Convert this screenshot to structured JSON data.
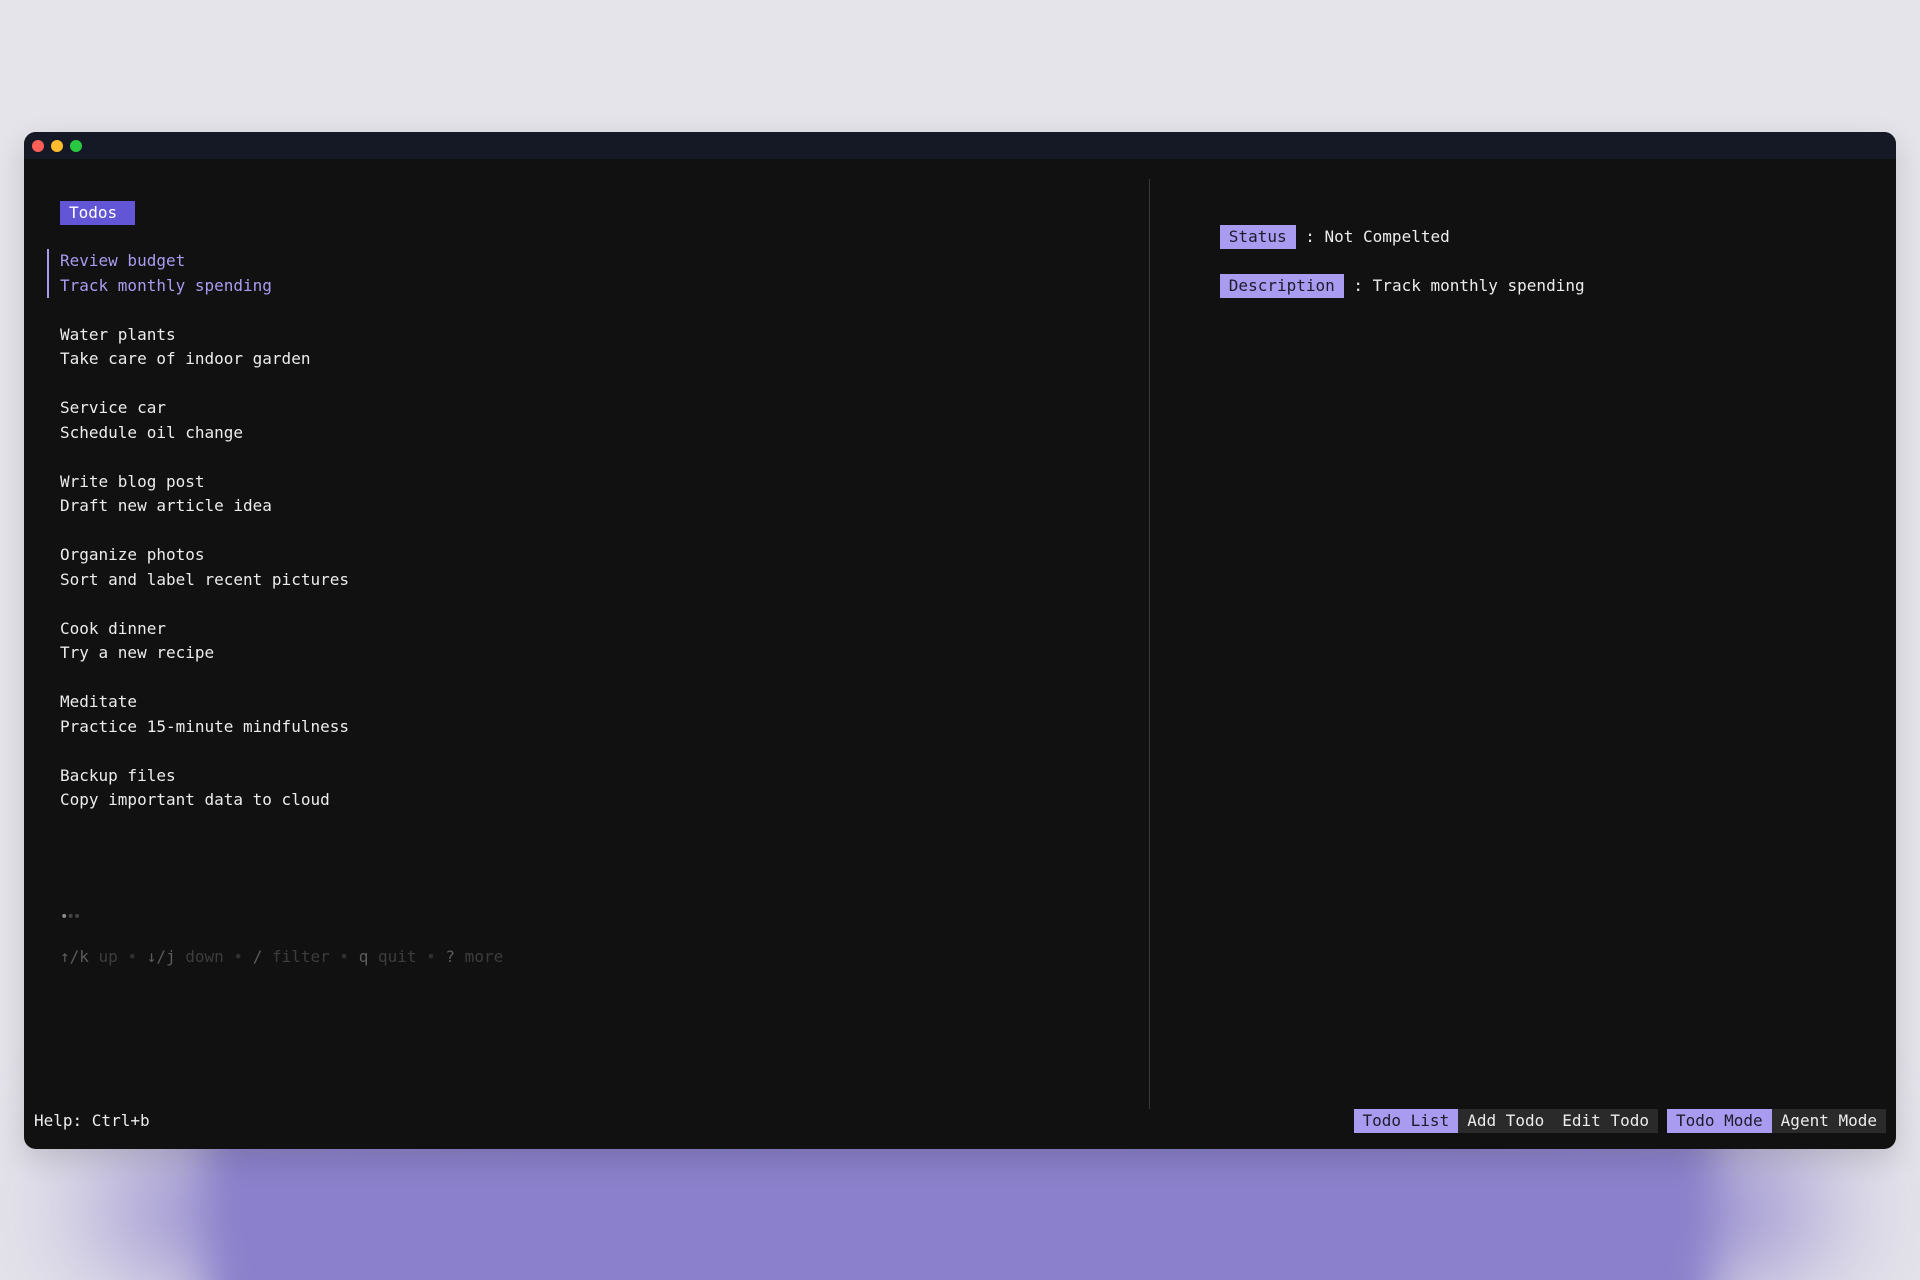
{
  "colors": {
    "accent": "#a99cf0",
    "accent_strong": "#6256d6",
    "divider": "#3a3a3a",
    "window_bg": "#111111",
    "titlebar_bg": "#141925",
    "close": "#ff5f57",
    "minimize": "#febc2e",
    "maximize": "#28c840",
    "tab_bg": "#2a2a2a"
  },
  "list": {
    "title": "Todos",
    "items": [
      {
        "title": "Review budget",
        "description": "Track monthly spending",
        "selected": true
      },
      {
        "title": "Water plants",
        "description": "Take care of indoor garden",
        "selected": false
      },
      {
        "title": "Service car",
        "description": "Schedule oil change",
        "selected": false
      },
      {
        "title": "Write blog post",
        "description": "Draft new article idea",
        "selected": false
      },
      {
        "title": "Organize photos",
        "description": "Sort and label recent pictures",
        "selected": false
      },
      {
        "title": "Cook dinner",
        "description": "Try a new recipe",
        "selected": false
      },
      {
        "title": "Meditate",
        "description": "Practice 15-minute mindfulness",
        "selected": false
      },
      {
        "title": "Backup files",
        "description": "Copy important data to cloud",
        "selected": false
      }
    ],
    "pager": "•••",
    "help": [
      {
        "key": "↑/k",
        "desc": "up"
      },
      {
        "key": "↓/j",
        "desc": "down"
      },
      {
        "key": "/",
        "desc": "filter"
      },
      {
        "key": "q",
        "desc": "quit"
      },
      {
        "key": "?",
        "desc": "more"
      }
    ],
    "help_separator": " • "
  },
  "detail": {
    "status_label": "Status",
    "status_value": ": Not Compelted",
    "description_label": "Description",
    "description_value": ": Track monthly spending"
  },
  "status_bar": {
    "help_hint": "Help: Ctrl+b",
    "view_tabs": [
      {
        "label": "Todo List",
        "active": true
      },
      {
        "label": "Add Todo",
        "active": false
      },
      {
        "label": "Edit Todo",
        "active": false
      }
    ],
    "mode_tabs": [
      {
        "label": "Todo Mode",
        "active": true
      },
      {
        "label": "Agent Mode",
        "active": false
      }
    ]
  }
}
